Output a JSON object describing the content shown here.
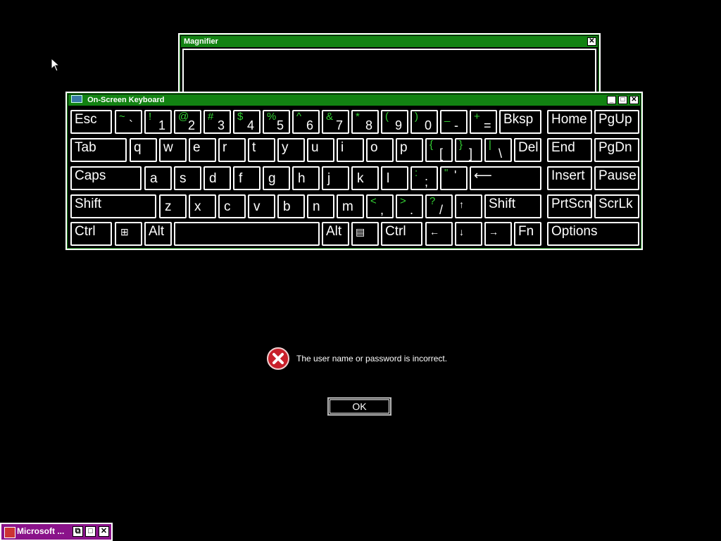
{
  "magnifier": {
    "title": "Magnifier",
    "close_glyph": "✕"
  },
  "osk": {
    "title": "On-Screen Keyboard",
    "controls": {
      "minimize": "_",
      "maximize": "□",
      "close": "✕"
    },
    "keys": {
      "esc": "Esc",
      "tilde_up": "~",
      "tilde_low": "`",
      "k1_up": "!",
      "k1": "1",
      "k2_up": "@",
      "k2": "2",
      "k3_up": "#",
      "k3": "3",
      "k4_up": "$",
      "k4": "4",
      "k5_up": "%",
      "k5": "5",
      "k6_up": "^",
      "k6": "6",
      "k7_up": "&",
      "k7": "7",
      "k8_up": "*",
      "k8": "8",
      "k9_up": "(",
      "k9": "9",
      "k0_up": ")",
      "k0": "0",
      "minus_up": "_",
      "minus": "-",
      "eq_up": "+",
      "eq": "=",
      "bksp": "Bksp",
      "home": "Home",
      "pgup": "PgUp",
      "tab": "Tab",
      "q": "q",
      "w": "w",
      "e": "e",
      "r": "r",
      "t": "t",
      "y": "y",
      "u": "u",
      "i": "i",
      "o": "o",
      "p": "p",
      "lbr_up": "{",
      "lbr": "[",
      "rbr_up": "}",
      "rbr": "]",
      "bsl_up": "|",
      "bsl": "\\",
      "del": "Del",
      "end": "End",
      "pgdn": "PgDn",
      "caps": "Caps",
      "a": "a",
      "s": "s",
      "d": "d",
      "f": "f",
      "g": "g",
      "h": "h",
      "j": "j",
      "k": "k",
      "l": "l",
      "semi_up": ":",
      "semi": ";",
      "quote_up": "\"",
      "quote": "'",
      "enter": "⟵",
      "insert": "Insert",
      "pause": "Pause",
      "shift": "Shift",
      "z": "z",
      "x": "x",
      "c": "c",
      "v": "v",
      "b": "b",
      "n": "n",
      "m": "m",
      "comma_up": "<",
      "comma": ",",
      "period_up": ">",
      "period": ".",
      "slash_up": "?",
      "slash": "/",
      "up": "↑",
      "shift_r": "Shift",
      "prtscn": "PrtScn",
      "scrlk": "ScrLk",
      "ctrl": "Ctrl",
      "win": "⊞",
      "alt": "Alt",
      "alt_r": "Alt",
      "menu": "▤",
      "ctrl_r": "Ctrl",
      "left": "←",
      "down": "↓",
      "right": "→",
      "fn": "Fn",
      "options": "Options"
    }
  },
  "dialog": {
    "message": "The user name or password is incorrect.",
    "ok_label": "OK"
  },
  "taskbar": {
    "item_label": "Microsoft ...",
    "controls": {
      "restore": "⧉",
      "maximize": "□",
      "close": "✕"
    }
  }
}
